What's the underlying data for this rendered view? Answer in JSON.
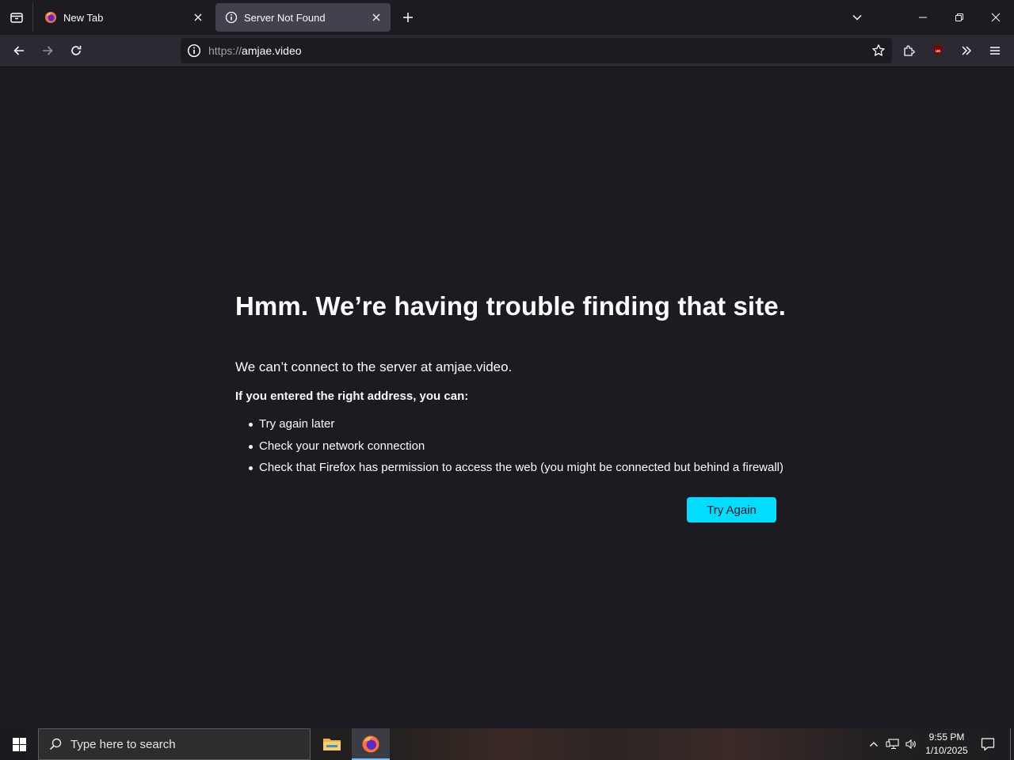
{
  "browser": {
    "tabs": [
      {
        "label": "New Tab",
        "icon": "firefox-icon",
        "active": false
      },
      {
        "label": "Server Not Found",
        "icon": "info-icon",
        "active": true
      }
    ],
    "url": {
      "scheme": "https://",
      "host": "amjae.video"
    }
  },
  "error_page": {
    "title": "Hmm. We’re having trouble finding that site.",
    "description": "We can’t connect to the server at amjae.video.",
    "subheading": "If you entered the right address, you can:",
    "suggestions": [
      "Try again later",
      "Check your network connection",
      "Check that Firefox has permission to access the web (you might be connected but behind a firewall)"
    ],
    "try_again_label": "Try Again"
  },
  "taskbar": {
    "search_placeholder": "Type here to search",
    "time": "9:55 PM",
    "date": "1/10/2025"
  },
  "colors": {
    "page_bg": "#1c1b22",
    "toolbar_bg": "#2b2a33",
    "active_tab_bg": "#42414d",
    "accent": "#00ddff",
    "ublock_red": "#800000"
  }
}
